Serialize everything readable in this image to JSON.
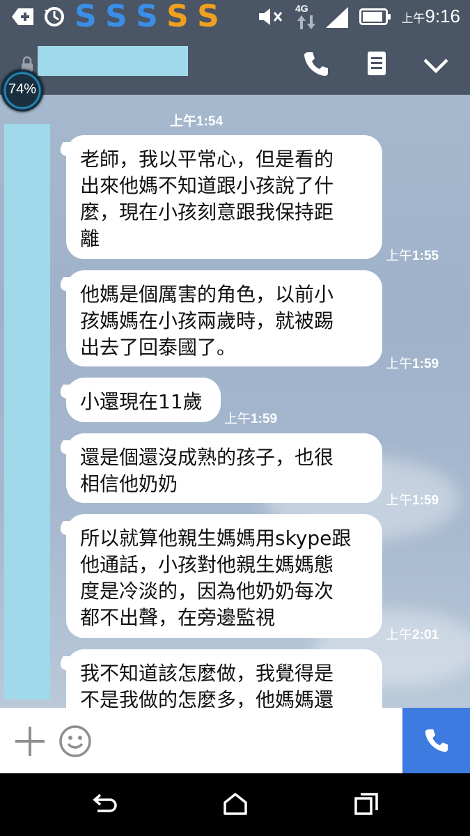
{
  "status_bar": {
    "time_ampm": "上午",
    "time": "9:16",
    "network": "4G",
    "icons": [
      "add-box-icon",
      "sync-icon",
      "s-icon",
      "s-icon",
      "s-icon",
      "s-icon",
      "s-icon",
      "mute-icon",
      "signal-icon",
      "battery-icon"
    ]
  },
  "battery_overlay": {
    "text": "74%"
  },
  "header": {
    "icons": [
      "lock-icon",
      "phone-icon",
      "notes-icon",
      "chevron-down-icon"
    ]
  },
  "chat": {
    "date_label": "上午1:54",
    "messages": [
      {
        "text": "老師，我以平常心，但是看的出來他媽不知道跟小孩說了什麼，現在小孩刻意跟我保持距離",
        "lines": [
          "老師，我以平常心，但是看的",
          "出來他媽不知道跟小孩說了什",
          "麼，現在小孩刻意跟我保持距",
          "離"
        ],
        "time_ampm": "上午",
        "time": "1:55"
      },
      {
        "text": "他媽是個厲害的角色，以前小孩媽媽在小孩兩歲時，就被踢出去了回泰國了。",
        "lines": [
          "他媽是個厲害的角色，以前小",
          "孩媽媽在小孩兩歲時，就被踢",
          "出去了回泰國了。"
        ],
        "time_ampm": "上午",
        "time": "1:59"
      },
      {
        "text": "小還現在11歲",
        "lines": [
          "小還現在11歲"
        ],
        "time_ampm": "上午",
        "time": "1:59"
      },
      {
        "text": "還是個還沒成熟的孩子，也很相信他奶奶",
        "lines": [
          "還是個還沒成熟的孩子，也很",
          "相信他奶奶"
        ],
        "time_ampm": "上午",
        "time": "1:59"
      },
      {
        "text": "所以就算他親生媽媽用skype跟他通話，小孩對他親生媽媽態度是冷淡的，因為他奶奶每次都不出聲，在旁邊監視",
        "lines": [
          "所以就算他親生媽媽用skype跟",
          "他通話，小孩對他親生媽媽態",
          "度是冷淡的，因為他奶奶每次",
          "都不出聲，在旁邊監視"
        ],
        "time_ampm": "上午",
        "time": "2:01"
      },
      {
        "text": "我不知道該怎麼做，我覺得是不是我做的怎麼多，他媽媽還",
        "lines": [
          "我不知道該怎麼做，我覺得是",
          "不是我做的怎麼多，他媽媽還"
        ],
        "time_ampm": "",
        "time": ""
      }
    ]
  },
  "input_bar": {
    "icons": [
      "plus-icon",
      "emoji-icon",
      "call-icon"
    ]
  },
  "nav_bar": {
    "icons": [
      "back-icon",
      "home-icon",
      "recents-icon"
    ]
  },
  "colors": {
    "bar": "#4a5565",
    "accent": "#3d7be0",
    "redacted": "#9fd9ea",
    "s_blue": "#3a8ee8",
    "s_orange": "#f0a020"
  }
}
